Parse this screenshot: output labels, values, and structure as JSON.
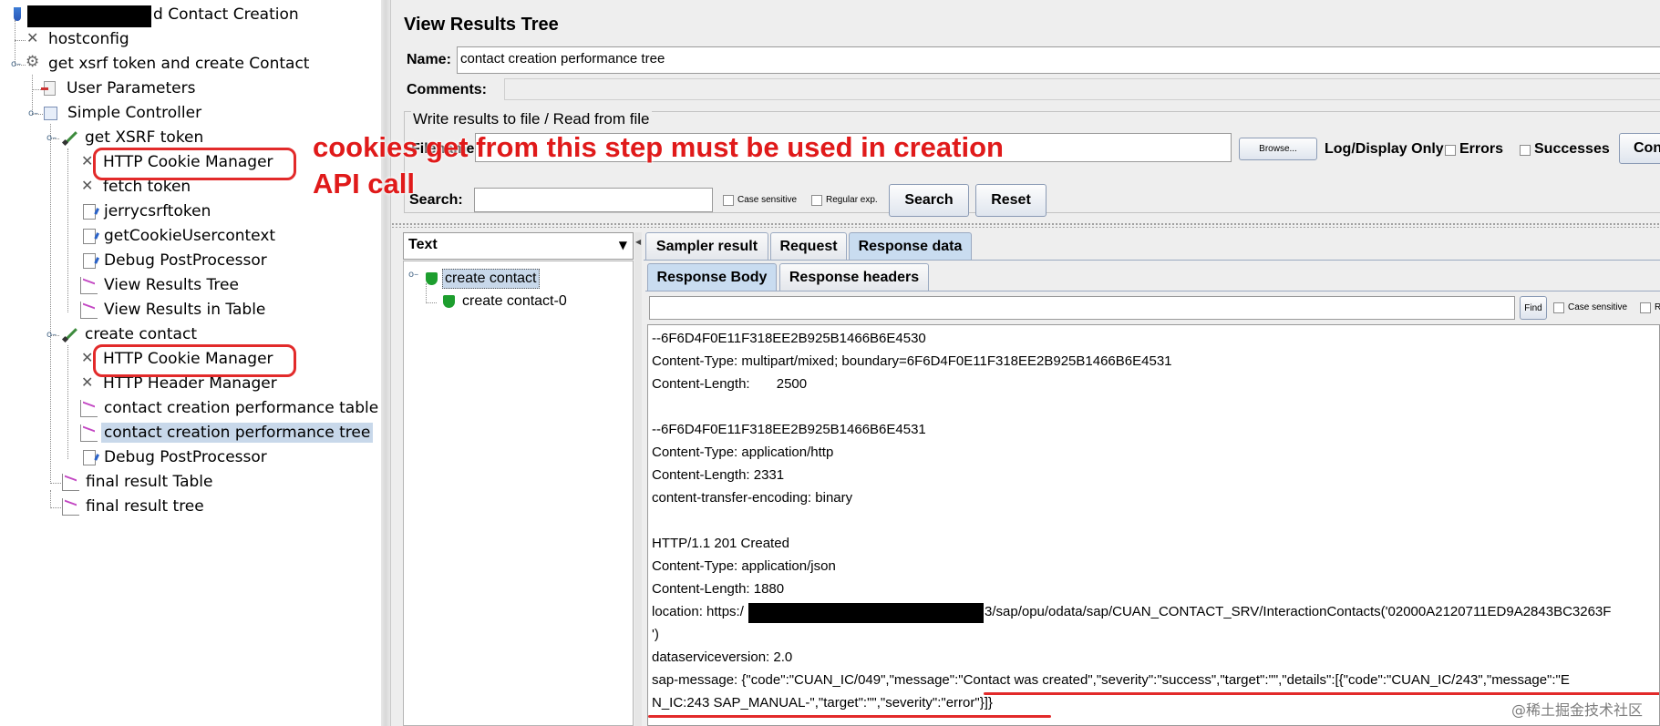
{
  "left_tree": {
    "root_label": "d Contact Creation",
    "items": {
      "hostconfig": "hostconfig",
      "get_xsrf_group": "get xsrf token and create Contact",
      "user_parameters": "User Parameters",
      "simple_controller": "Simple Controller",
      "get_xsrf_token": "get XSRF token",
      "cookie_manager_1": "HTTP Cookie Manager",
      "fetch_token": "fetch token",
      "jerrycsrftoken": "jerrycsrftoken",
      "get_cookie_usercontext": "getCookieUsercontext",
      "debug_pp_1": "Debug PostProcessor",
      "view_results_tree": "View Results Tree",
      "view_results_table": "View Results in Table",
      "create_contact": "create contact",
      "cookie_manager_2": "HTTP Cookie Manager",
      "header_manager": "HTTP Header Manager",
      "perf_table": "contact creation performance table",
      "perf_tree": "contact creation performance tree",
      "debug_pp_2": "Debug PostProcessor",
      "final_table": "final result Table",
      "final_tree": "final result tree"
    }
  },
  "annotation": {
    "line1": "cookies get from this step must be used in creation",
    "line2": "API call",
    "color": "#e01a1a"
  },
  "panel": {
    "title": "View Results Tree",
    "name_label": "Name:",
    "name_value": "contact creation performance tree",
    "comments_label": "Comments:",
    "file_group_title": "Write results to file / Read from file",
    "filename_label": "Filename",
    "browse_label": "Browse...",
    "log_display_label": "Log/Display Only:",
    "errors_label": "Errors",
    "successes_label": "Successes",
    "configure_label": "Con",
    "search_label": "Search:",
    "case_sensitive_label": "Case sensitive",
    "regular_exp_label": "Regular exp.",
    "search_button": "Search",
    "reset_button": "Reset"
  },
  "results": {
    "renderer": "Text",
    "samples": [
      "create contact",
      "create contact-0"
    ]
  },
  "tabs": {
    "sampler_result": "Sampler result",
    "request": "Request",
    "response_data": "Response data",
    "response_body": "Response Body",
    "response_headers": "Response headers",
    "find_button": "Find",
    "find_case_sensitive": "Case sensitive",
    "find_regex": "R"
  },
  "response": {
    "lines": [
      "--6F6D4F0E11F318EE2B925B1466B6E4530",
      "Content-Type: multipart/mixed; boundary=6F6D4F0E11F318EE2B925B1466B6E4531",
      "Content-Length:       2500",
      "",
      "--6F6D4F0E11F318EE2B925B1466B6E4531",
      "Content-Type: application/http",
      "Content-Length: 2331",
      "content-transfer-encoding: binary",
      "",
      "HTTP/1.1 201 Created",
      "Content-Type: application/json",
      "Content-Length: 1880",
      "",
      "')",
      "dataserviceversion: 2.0",
      "sap-message: {\"code\":\"CUAN_IC/049\",\"message\":\"Contact was created\",\"severity\":\"success\",\"target\":\"\",\"details\":[{\"code\":\"CUAN_IC/243\",\"message\":\"E",
      "N_IC:243 SAP_MANUAL-\",\"target\":\"\",\"severity\":\"error\"}]}"
    ],
    "location_prefix": "location: https:/",
    "location_suffix": "3/sap/opu/odata/sap/CUAN_CONTACT_SRV/InteractionContacts('02000A2120711ED9A2843BC3263F"
  },
  "watermark": "@稀土掘金技术社区",
  "colors": {
    "selection": "#c8d8ea",
    "highlight_red": "#e22a2a",
    "active_tab": "#c9dcf0"
  }
}
